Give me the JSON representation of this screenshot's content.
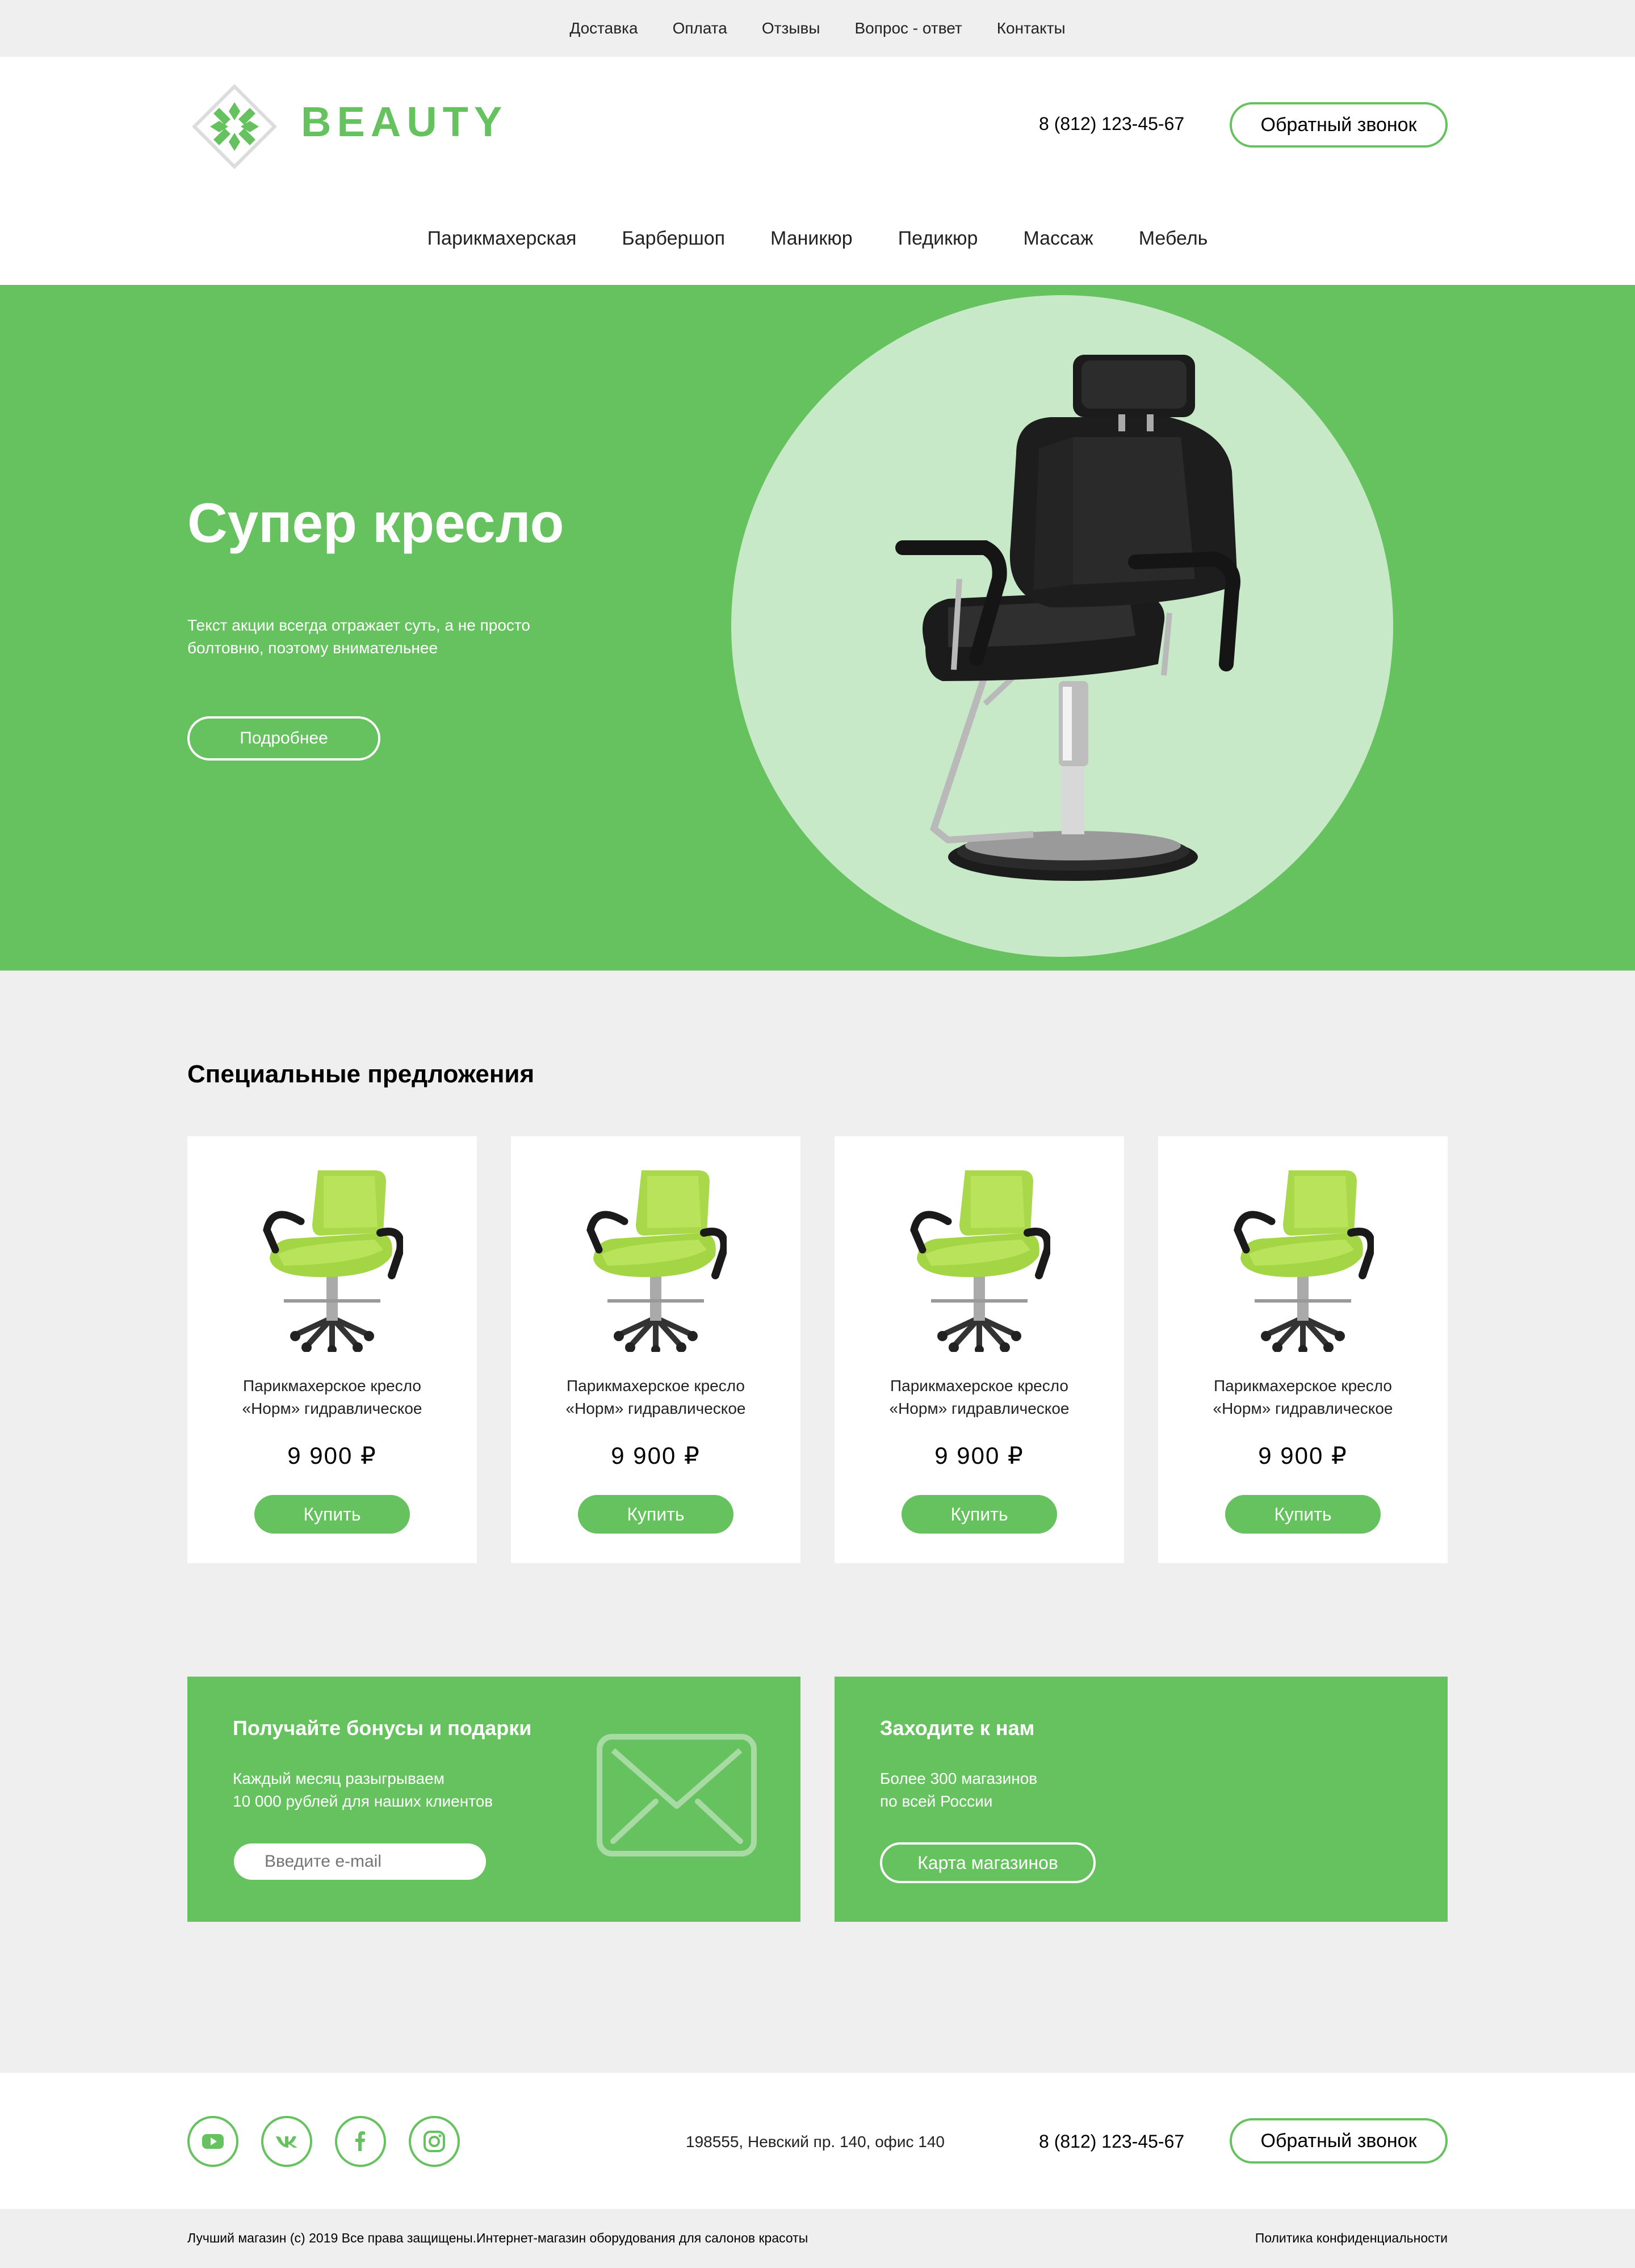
{
  "colors": {
    "accent": "#66c25f",
    "accent_light": "#c8e9c8",
    "background": "#efefef"
  },
  "top_nav": [
    "Доставка",
    "Оплата",
    "Отзывы",
    "Вопрос - ответ",
    "Контакты"
  ],
  "header": {
    "logo_text": "BEAUTY",
    "phone": "8 (812) 123-45-67",
    "callback_label": "Обратный звонок"
  },
  "main_nav": [
    "Парикмахерская",
    "Барбершоп",
    "Маникюр",
    "Педикюр",
    "Массаж",
    "Мебель"
  ],
  "hero": {
    "title": "Супер кресло",
    "text": "Текст акции всегда отражает суть, а не просто болтовню, поэтому внимательнее",
    "button": "Подробнее"
  },
  "special": {
    "title": "Специальные предложения",
    "products": [
      {
        "name": "Парикмахерское кресло «Норм» гидравлическое",
        "price": "9 900 ₽",
        "buy": "Купить"
      },
      {
        "name": "Парикмахерское кресло «Норм» гидравлическое",
        "price": "9 900 ₽",
        "buy": "Купить"
      },
      {
        "name": "Парикмахерское кресло «Норм» гидравлическое",
        "price": "9 900 ₽",
        "buy": "Купить"
      },
      {
        "name": "Парикмахерское кресло «Норм» гидравлическое",
        "price": "9 900 ₽",
        "buy": "Купить"
      }
    ]
  },
  "bonus": {
    "title": "Получайте бонусы и подарки",
    "text_line1": "Каждый месяц разыгрываем",
    "text_line2": "10 000 рублей для наших клиентов",
    "email_placeholder": "Введите e-mail"
  },
  "stores": {
    "title": "Заходите к нам",
    "text_line1": "Более 300 магазинов",
    "text_line2": "по всей России",
    "button": "Карта магазинов"
  },
  "footer": {
    "socials": [
      "youtube-icon",
      "vk-icon",
      "facebook-icon",
      "instagram-icon"
    ],
    "address": "198555, Невский пр. 140, офис 140",
    "phone": "8 (812) 123-45-67",
    "callback_label": "Обратный звонок",
    "copyright": "Лучший магазин (c) 2019 Все права защищены.Интернет-магазин оборудования для салонов красоты",
    "policy": "Политика конфиденциальности"
  }
}
